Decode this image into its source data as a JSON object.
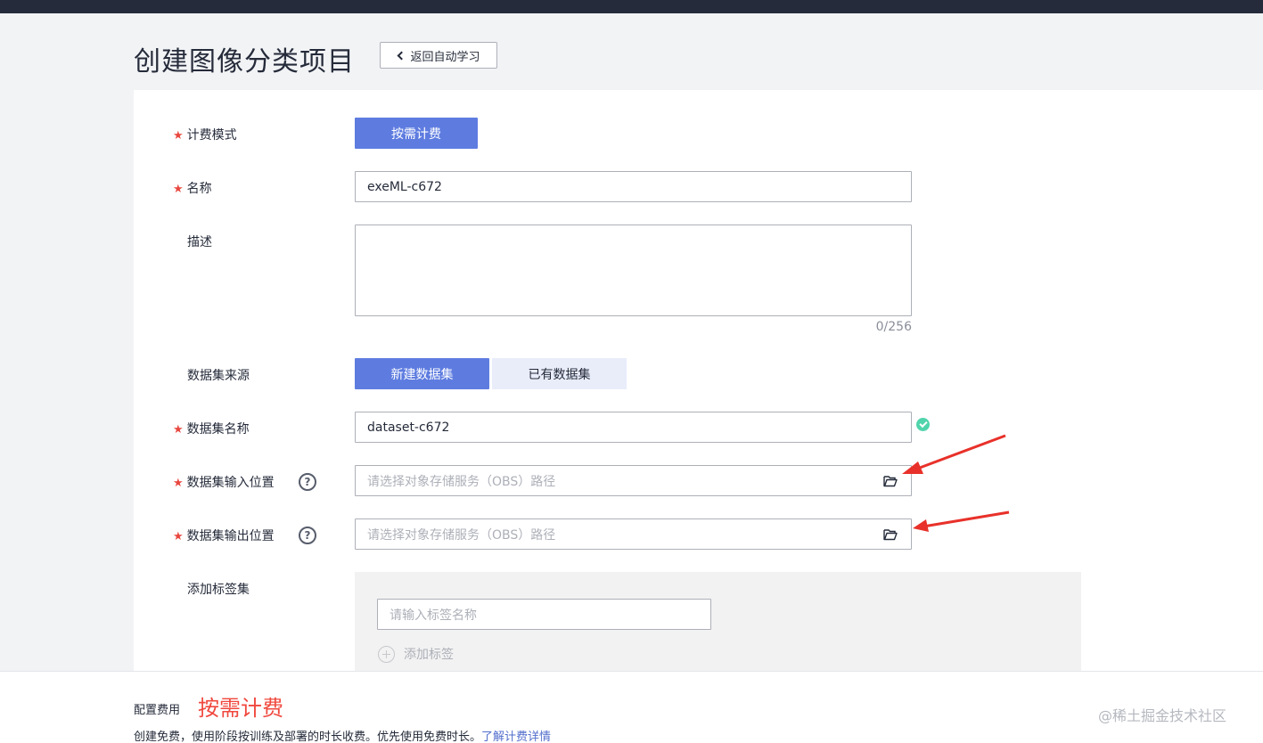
{
  "header": {
    "page_title": "创建图像分类项目",
    "back_label": "返回自动学习"
  },
  "form": {
    "billing_mode": {
      "label": "计费模式",
      "required": "★",
      "value": "按需计费"
    },
    "name": {
      "label": "名称",
      "required": "★",
      "value": "exeML-c672"
    },
    "description": {
      "label": "描述",
      "value": "",
      "counter": "0/256"
    },
    "dataset_source": {
      "label": "数据集来源",
      "options": [
        "新建数据集",
        "已有数据集"
      ],
      "selected": "新建数据集"
    },
    "dataset_name": {
      "label": "数据集名称",
      "required": "★",
      "value": "dataset-c672"
    },
    "dataset_input": {
      "label": "数据集输入位置",
      "required": "★",
      "help": "?",
      "placeholder": "请选择对象存储服务（OBS）路径"
    },
    "dataset_output": {
      "label": "数据集输出位置",
      "required": "★",
      "help": "?",
      "placeholder": "请选择对象存储服务（OBS）路径"
    },
    "label_set": {
      "label": "添加标签集",
      "input_placeholder": "请输入标签名称",
      "add_label": "添加标签"
    }
  },
  "footer": {
    "fee_label": "配置费用",
    "fee_value": "按需计费",
    "fee_desc": "创建免费，使用阶段按训练及部署的时长收费。优先使用免费时长。",
    "fee_link": "了解计费详情"
  },
  "watermark": "@稀土掘金技术社区",
  "colors": {
    "primary": "#5e7ce0",
    "required": "#e8473f",
    "success": "#50d4ab",
    "fee_red": "#f0483e",
    "arrow_red": "#e8312a",
    "link": "#526ecc"
  }
}
